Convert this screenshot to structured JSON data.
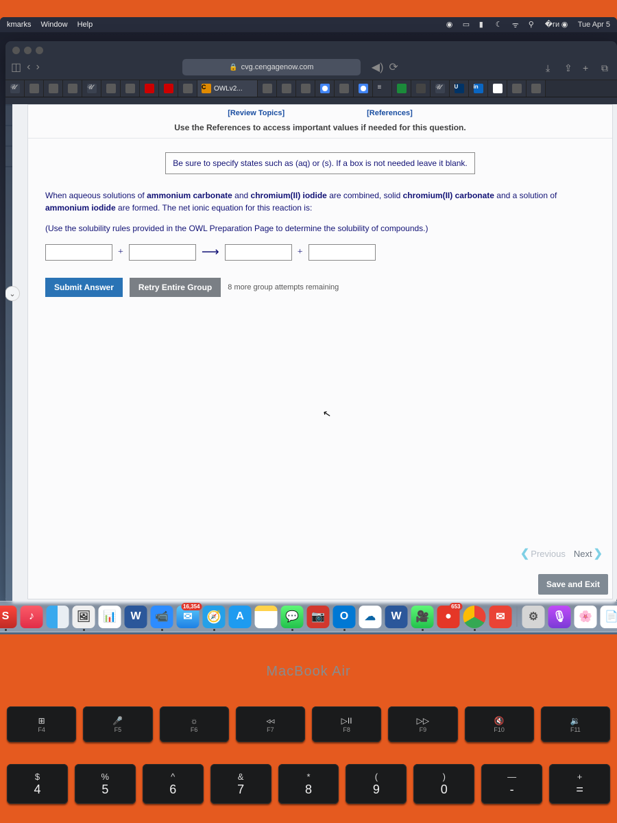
{
  "menubar": {
    "items": [
      "kmarks",
      "Window",
      "Help"
    ],
    "clock": "Tue Apr 5"
  },
  "safari": {
    "url": "cvg.cengagenow.com",
    "active_tab_label": "OWLv2..."
  },
  "links": {
    "review": "[Review Topics]",
    "references": "[References]"
  },
  "instr": "Use the References to access important values if needed for this question.",
  "hint": "Be sure to specify states such as (aq) or (s).  If a box is not needed leave it blank.",
  "q": {
    "p1a": "When aqueous solutions of ",
    "p1b": "ammonium carbonate",
    "p1c": " and ",
    "p1d": "chromium(II) iodide",
    "p1e": " are combined, solid ",
    "p2a": "chromium(II) carbonate",
    "p2b": " and a solution of ",
    "p2c": "ammonium iodide",
    "p2d": " are formed. The net ionic equation for this reaction is:",
    "p3": "(Use the solubility rules provided in the OWL Preparation Page to determine the solubility of compounds.)"
  },
  "buttons": {
    "submit": "Submit Answer",
    "retry": "Retry Entire Group",
    "previous": "Previous",
    "next": "Next",
    "save": "Save and Exit"
  },
  "attempts": "8 more group attempts remaining",
  "mba": "MacBook Air",
  "fn": [
    {
      "sym": "⊞",
      "lab": "F4"
    },
    {
      "sym": "🎤",
      "lab": "F5"
    },
    {
      "sym": "☼",
      "lab": "F6"
    },
    {
      "sym": "◃◃",
      "lab": "F7"
    },
    {
      "sym": "▷II",
      "lab": "F8"
    },
    {
      "sym": "▷▷",
      "lab": "F9"
    },
    {
      "sym": "🔇",
      "lab": "F10"
    },
    {
      "sym": "🔉",
      "lab": "F11"
    }
  ],
  "num": [
    {
      "sym": "$",
      "lab": "4"
    },
    {
      "sym": "%",
      "lab": "5"
    },
    {
      "sym": "^",
      "lab": "6"
    },
    {
      "sym": "&",
      "lab": "7"
    },
    {
      "sym": "*",
      "lab": "8"
    },
    {
      "sym": "(",
      "lab": "9"
    },
    {
      "sym": ")",
      "lab": "0"
    },
    {
      "sym": "—",
      "lab": "-"
    },
    {
      "sym": "+",
      "lab": "="
    }
  ],
  "dock_badges": {
    "mail": "16,354",
    "red": "653"
  }
}
